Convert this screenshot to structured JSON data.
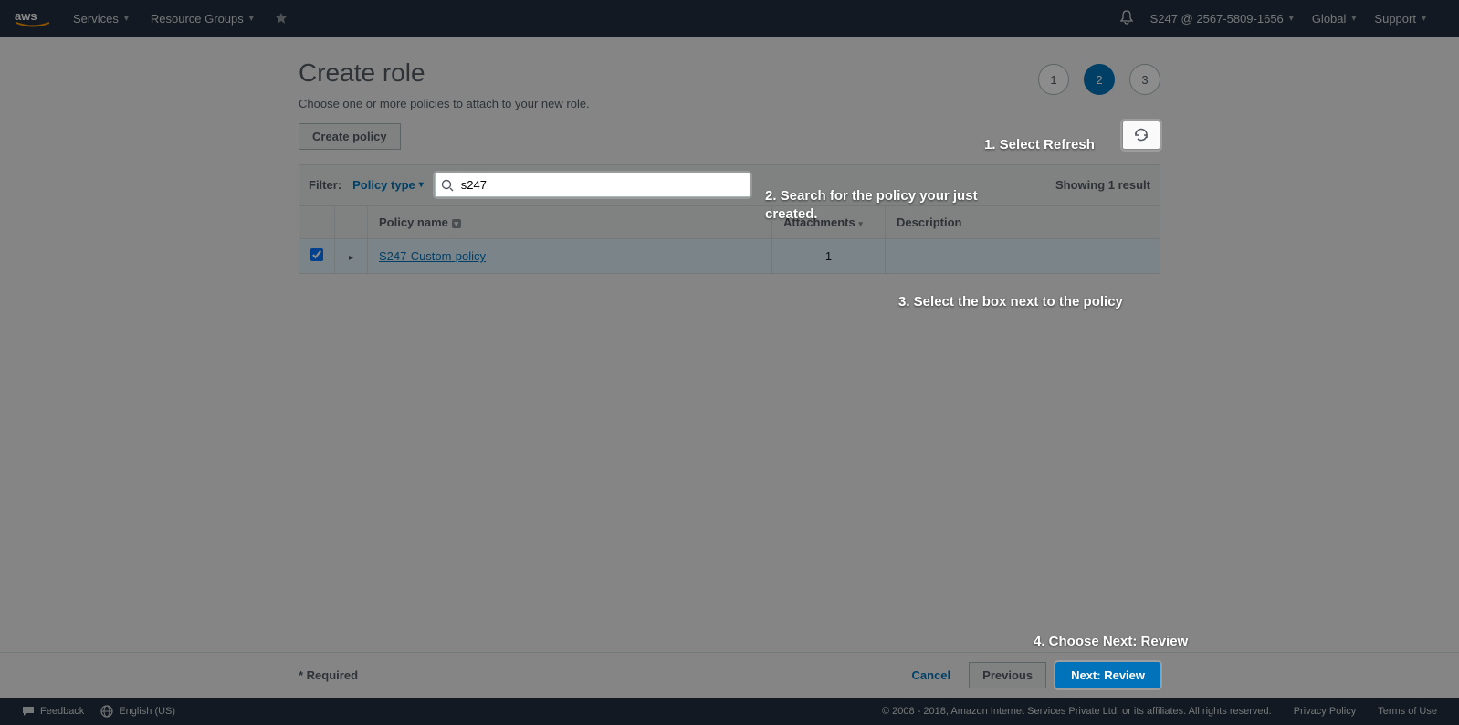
{
  "nav": {
    "services": "Services",
    "resource_groups": "Resource Groups",
    "account": "S247 @ 2567-5809-1656",
    "region": "Global",
    "support": "Support"
  },
  "page": {
    "title": "Create role",
    "subtitle": "Choose one or more policies to attach to your new role.",
    "create_policy": "Create policy",
    "steps": [
      "1",
      "2",
      "3"
    ],
    "active_step": 1
  },
  "filter": {
    "label": "Filter:",
    "type_label": "Policy type",
    "search_value": "s247",
    "showing": "Showing 1 result"
  },
  "table": {
    "col_policy_name": "Policy name",
    "col_attachments": "Attachments",
    "col_description": "Description",
    "rows": [
      {
        "checked": true,
        "name": "S247-Custom-policy",
        "attachments": "1",
        "description": ""
      }
    ]
  },
  "footer": {
    "required": "* Required",
    "cancel": "Cancel",
    "previous": "Previous",
    "next": "Next: Review"
  },
  "legal": {
    "feedback": "Feedback",
    "language": "English (US)",
    "copyright": "© 2008 - 2018, Amazon Internet Services Private Ltd. or its affiliates. All rights reserved.",
    "privacy": "Privacy Policy",
    "terms": "Terms of Use"
  },
  "annotations": {
    "a1": "1. Select Refresh",
    "a2": "2. Search for the policy your just created.",
    "a3": "3. Select the box next to the policy",
    "a4": "4. Choose Next: Review"
  }
}
